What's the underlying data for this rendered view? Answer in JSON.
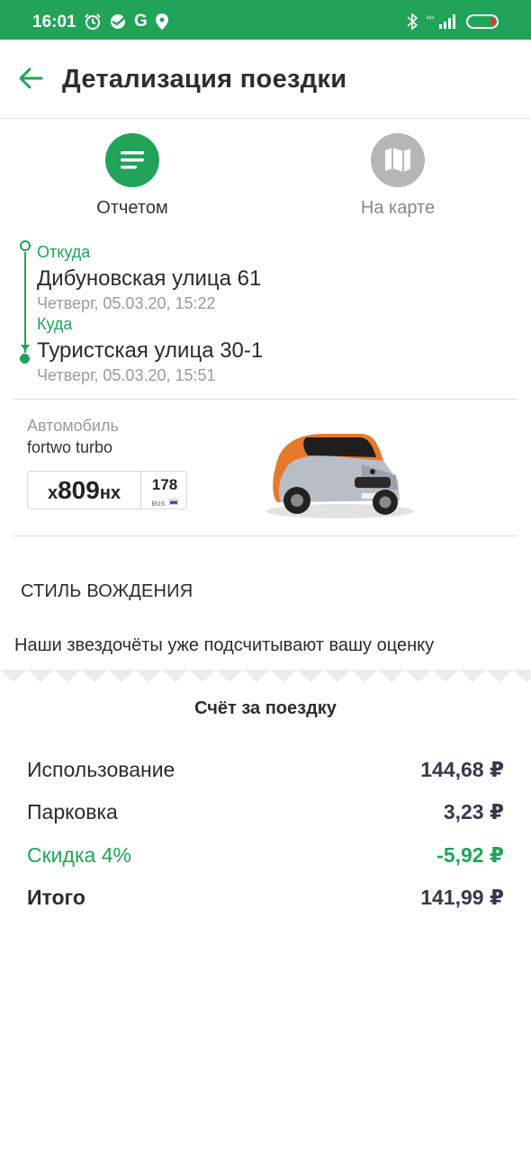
{
  "status_bar": {
    "time": "16:01",
    "g_letter": "G",
    "icons": [
      "alarm-icon",
      "sber-icon",
      "google-icon",
      "location-icon",
      "bluetooth-icon",
      "signal-icon",
      "battery-icon"
    ]
  },
  "header": {
    "title": "Детализация поездки",
    "back_icon": "arrow-left-icon"
  },
  "tabs": [
    {
      "label": "Отчетом",
      "icon": "list-icon",
      "active": true
    },
    {
      "label": "На карте",
      "icon": "map-icon",
      "active": false
    }
  ],
  "route": {
    "from": {
      "label": "Откуда",
      "address": "Дибуновская улица 61",
      "time": "Четверг, 05.03.20, 15:22"
    },
    "to": {
      "label": "Куда",
      "address": "Туристская улица 30-1",
      "time": "Четверг, 05.03.20, 15:51"
    }
  },
  "car": {
    "caption": "Автомобиль",
    "model": "fortwo turbo",
    "plate": {
      "prefix": "х",
      "number": "809",
      "suffix": "нх",
      "region": "178",
      "country": "RUS"
    }
  },
  "driving_style": {
    "title": "СТИЛЬ ВОЖДЕНИЯ",
    "message": "Наши звездочёты уже подсчитывают вашу оценку"
  },
  "bill": {
    "title": "Счёт за поездку",
    "rows": [
      {
        "name": "Использование",
        "amount": "144,68 ₽"
      },
      {
        "name": "Парковка",
        "amount": "3,23 ₽"
      },
      {
        "name": "Скидка 4%",
        "amount": "-5,92 ₽"
      },
      {
        "name": "Итого",
        "amount": "141,99 ₽"
      }
    ]
  },
  "colors": {
    "accent": "#21a359",
    "inactive": "#b6b6b6",
    "text": "#2b2b2b",
    "muted": "#9a9a9a"
  }
}
